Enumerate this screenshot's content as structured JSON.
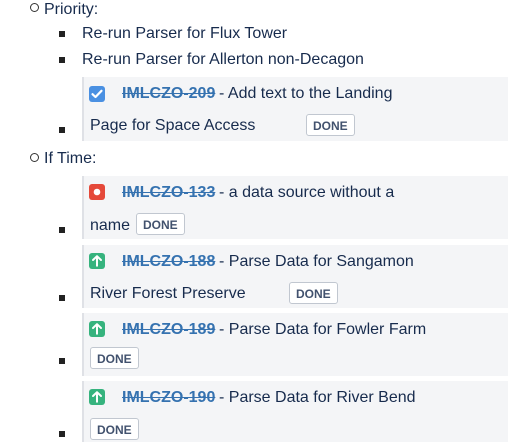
{
  "top": {
    "label": "Priority:"
  },
  "priority_items": [
    "Re-run Parser for Flux Tower",
    "Re-run Parser for Allerton non-Decagon"
  ],
  "priority_issue": {
    "key": "IMLCZO-209",
    "summary_line1": " - Add text to the Landing",
    "summary_line2": "Page for Space Access",
    "status": "DONE",
    "icon": "task-checkbox-icon",
    "icon_color": "#4a90e2"
  },
  "if_time": {
    "label": "If Time:"
  },
  "if_time_issues": [
    {
      "key": "IMLCZO-133",
      "summary_line1": " - a data source without a",
      "summary_line2": "name",
      "status": "DONE",
      "icon": "bug-icon",
      "icon_color": "#e5493a"
    },
    {
      "key": "IMLCZO-188",
      "summary_line1": " - Parse Data for Sangamon",
      "summary_line2": "River Forest Preserve",
      "status": "DONE",
      "icon": "improvement-arrow-icon",
      "icon_color": "#36b37e"
    },
    {
      "key": "IMLCZO-189",
      "summary_line1": " - Parse Data for Fowler Farm",
      "summary_line2": "",
      "status": "DONE",
      "icon": "improvement-arrow-icon",
      "icon_color": "#36b37e"
    },
    {
      "key": "IMLCZO-190",
      "summary_line1": " - Parse Data for River Bend",
      "summary_line2": "",
      "status": "DONE",
      "icon": "improvement-arrow-icon",
      "icon_color": "#36b37e"
    }
  ]
}
